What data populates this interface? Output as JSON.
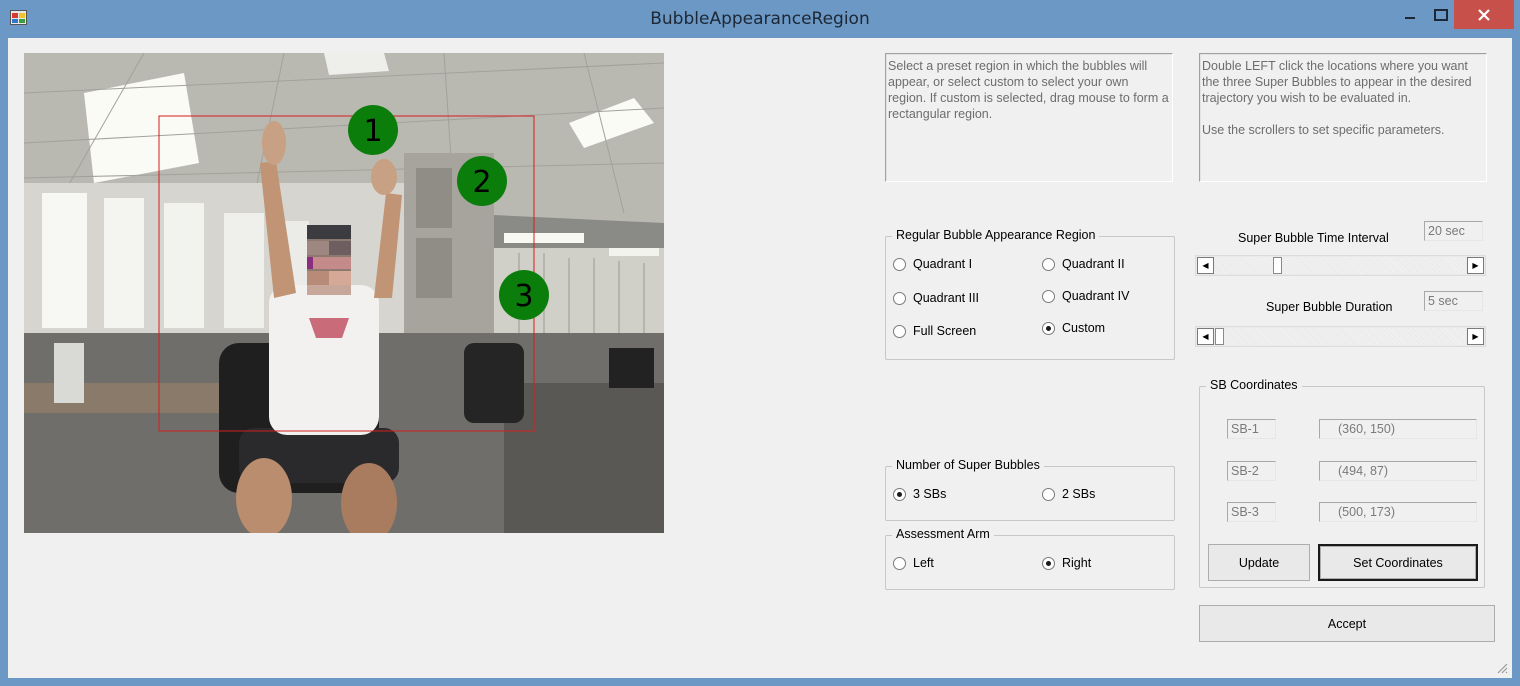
{
  "window": {
    "title": "BubbleAppearanceRegion",
    "minimize_glyph": "—",
    "maximize_glyph": "☐",
    "close_glyph": "✕"
  },
  "camera": {
    "bubbles": [
      {
        "label": "1"
      },
      {
        "label": "2"
      },
      {
        "label": "3"
      }
    ],
    "bubble_color": "#0b7d0b",
    "region_color": "#d21f1f"
  },
  "info": {
    "left_text": "Select a preset region in which the bubbles will appear, or select custom to select your own region. If custom is selected, drag mouse to form a rectangular region.",
    "right_text": "Double LEFT click the locations where you want the three Super Bubbles to appear in the desired trajectory you wish to be evaluated in.\n\nUse the scrollers to set specific parameters."
  },
  "region_group": {
    "title": "Regular Bubble Appearance Region",
    "options": [
      {
        "label": "Quadrant I",
        "checked": false
      },
      {
        "label": "Quadrant II",
        "checked": false
      },
      {
        "label": "Quadrant III",
        "checked": false
      },
      {
        "label": "Quadrant IV",
        "checked": false
      },
      {
        "label": "Full Screen",
        "checked": false
      },
      {
        "label": "Custom",
        "checked": true
      }
    ]
  },
  "super_bubbles_group": {
    "title": "Number of Super Bubbles",
    "options": [
      {
        "label": "3 SBs",
        "checked": true
      },
      {
        "label": "2 SBs",
        "checked": false
      }
    ]
  },
  "arm_group": {
    "title": "Assessment Arm",
    "options": [
      {
        "label": "Left",
        "checked": false
      },
      {
        "label": "Right",
        "checked": true
      }
    ]
  },
  "time_interval": {
    "label": "Super Bubble Time Interval",
    "value": "20 sec",
    "scroll_fraction": 0.24
  },
  "duration": {
    "label": "Super Bubble Duration",
    "value": "5 sec",
    "scroll_fraction": 0.0
  },
  "scroll_arrows": {
    "left": "◀",
    "right": "▶"
  },
  "coords_group": {
    "title": "SB Coordinates",
    "rows": [
      {
        "name": "SB-1",
        "value": "(360, 150)"
      },
      {
        "name": "SB-2",
        "value": "(494, 87)"
      },
      {
        "name": "SB-3",
        "value": "(500, 173)"
      }
    ],
    "update_label": "Update",
    "set_label": "Set Coordinates"
  },
  "accept_label": "Accept"
}
